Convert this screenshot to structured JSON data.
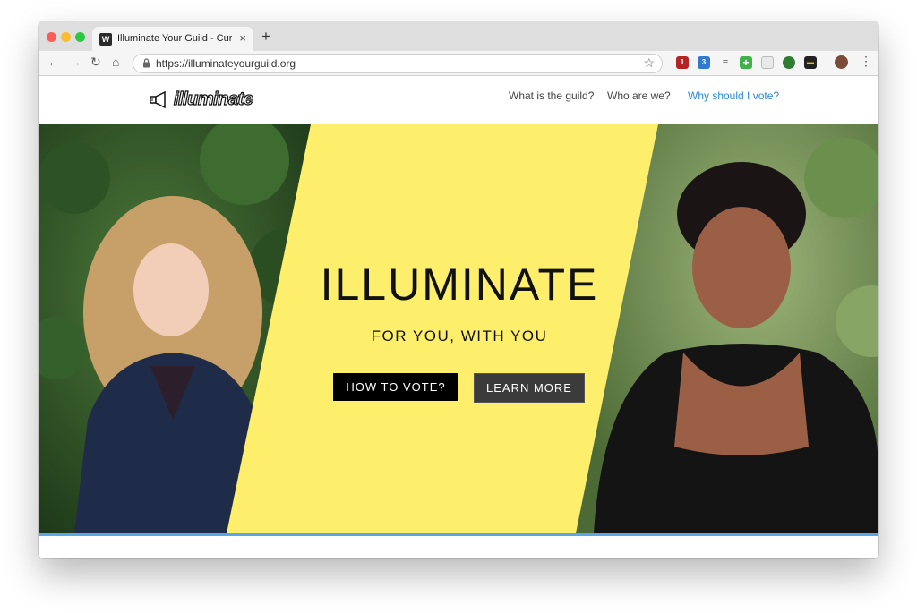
{
  "browser": {
    "tab_title": "Illuminate Your Guild - Curtin S",
    "tab_favicon_letter": "W",
    "url": "https://illuminateyourguild.org",
    "extensions": [
      {
        "name": "ublock-extension",
        "badge": "1",
        "color": "#b32424"
      },
      {
        "name": "s-extension",
        "badge": "3",
        "color": "#2f7ad0"
      },
      {
        "name": "list-extension",
        "badge": "",
        "color": "#666666"
      },
      {
        "name": "plus-extension",
        "badge": "",
        "color": "#3fb24a"
      },
      {
        "name": "clipboard-extension",
        "badge": "",
        "color": "#c33333"
      },
      {
        "name": "green-circle-extension",
        "badge": "",
        "color": "#2e7d32"
      },
      {
        "name": "yellow-extension",
        "badge": "",
        "color": "#f5b800"
      }
    ]
  },
  "site": {
    "logo_text": "illuminate",
    "nav": {
      "item1": "What is the guild?",
      "item2": "Who are we?",
      "item3": "Why should I vote?"
    }
  },
  "hero": {
    "title": "ILLUMINATE",
    "subtitle": "FOR YOU, WITH YOU",
    "vote_button": "HOW TO VOTE?",
    "more_button": "LEARN MORE",
    "accent_yellow": "#fdee6b",
    "divider_color": "#5aa7e6"
  },
  "icons": {
    "back": "←",
    "forward": "→",
    "reload": "↻",
    "home": "⌂",
    "lock": "🔒",
    "star": "☆",
    "close": "×",
    "new_tab": "+",
    "menu": "⋮"
  }
}
